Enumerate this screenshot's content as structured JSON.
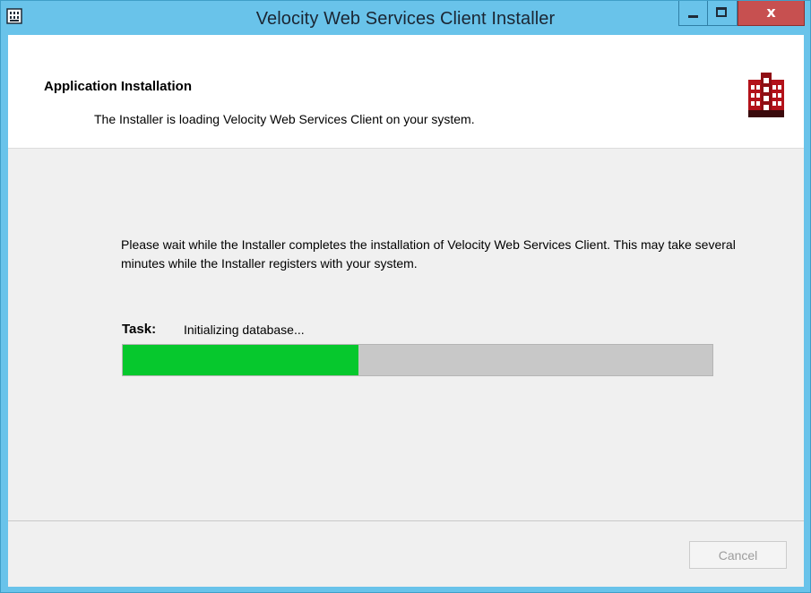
{
  "window": {
    "title": "Velocity Web Services Client Installer",
    "close_glyph": "x"
  },
  "header": {
    "title": "Application Installation",
    "subtitle": "The Installer is loading Velocity Web Services Client on your system."
  },
  "main": {
    "message": "Please wait while the Installer completes the installation of Velocity Web Services Client.  This may take several minutes while the Installer registers with your system.",
    "task_label": "Task:",
    "task_value": "Initializing database...",
    "progress_percent": 40
  },
  "footer": {
    "cancel_label": "Cancel"
  },
  "icons": {
    "app_icon": "installer-app-icon",
    "brand_logo": "velocity-logo-icon",
    "minimize": "minimize-icon",
    "maximize": "maximize-icon",
    "close": "close-icon"
  },
  "colors": {
    "titlebar": "#69c3ea",
    "close_button": "#c75050",
    "progress_fill": "#06c82d",
    "progress_track": "#c8c8c8",
    "logo_red": "#b3121a"
  }
}
